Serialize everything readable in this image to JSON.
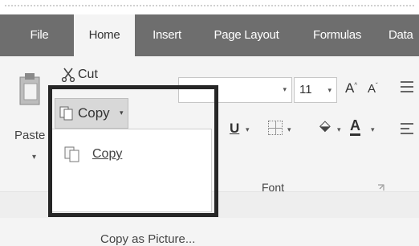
{
  "tabs": [
    {
      "label": "File",
      "active": false
    },
    {
      "label": "Home",
      "active": true
    },
    {
      "label": "Insert",
      "active": false
    },
    {
      "label": "Page Layout",
      "active": false
    },
    {
      "label": "Formulas",
      "active": false
    },
    {
      "label": "Data",
      "active": false
    }
  ],
  "clipboard": {
    "paste_label": "Paste",
    "cut_label": "Cut",
    "copy_button_label": "Copy",
    "dropdown": {
      "copy_item": "Copy",
      "copy_as_picture_item": "Copy as Picture..."
    }
  },
  "font_group": {
    "font_name": "",
    "font_size": "11",
    "label": "Font"
  },
  "colors": {
    "tabbar": "#6e6e6e",
    "ribbon": "#f4f4f4",
    "highlight_frame": "#262626"
  },
  "icons": [
    "paste-icon",
    "cut-icon",
    "copy-icon",
    "grow-font-icon",
    "shrink-font-icon",
    "underline-icon",
    "border-icon",
    "fill-color-icon",
    "font-color-icon",
    "align-icon",
    "dialog-launcher-icon"
  ]
}
